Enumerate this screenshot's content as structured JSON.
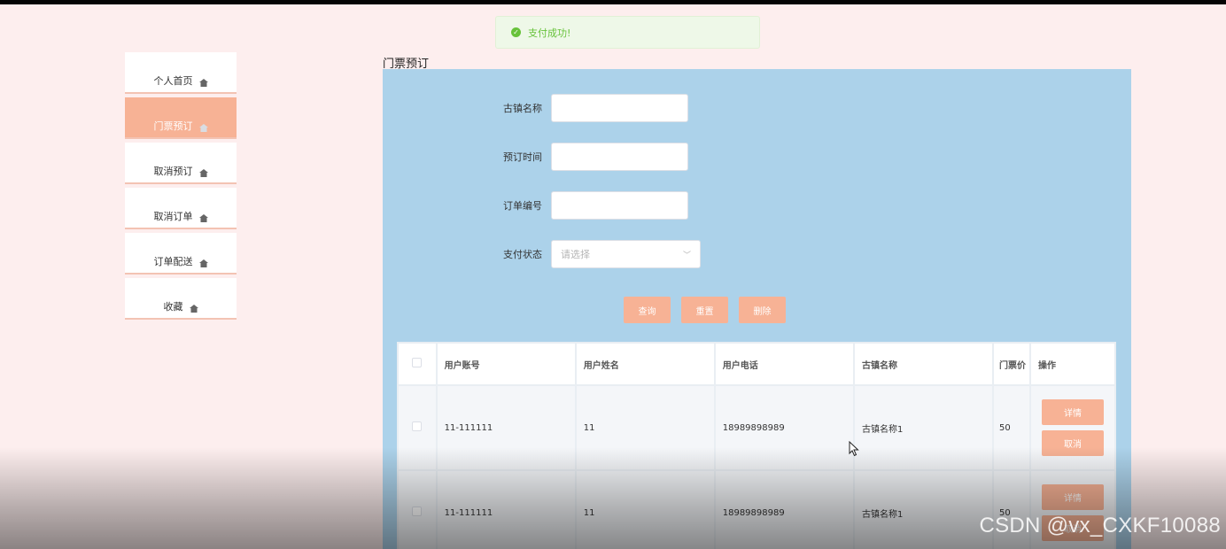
{
  "toast": {
    "message": "支付成功!"
  },
  "sidebar": {
    "items": [
      {
        "label": "个人首页",
        "icon": "house-icon",
        "active": false
      },
      {
        "label": "门票预订",
        "icon": "house-icon",
        "active": true
      },
      {
        "label": "取消预订",
        "icon": "house-icon",
        "active": false
      },
      {
        "label": "取消订单",
        "icon": "house-icon",
        "active": false
      },
      {
        "label": "订单配送",
        "icon": "house-icon",
        "active": false
      },
      {
        "label": "收藏",
        "icon": "house-icon",
        "active": false
      }
    ]
  },
  "page": {
    "title": "门票预订"
  },
  "form": {
    "town_name_label": "古镇名称",
    "town_name_value": "",
    "booking_time_label": "预订时间",
    "booking_time_value": "",
    "order_no_label": "订单编号",
    "order_no_value": "",
    "pay_status_label": "支付状态",
    "pay_status_placeholder": "请选择"
  },
  "buttons": {
    "search": "查询",
    "reset": "重置",
    "delete": "删除"
  },
  "table": {
    "columns": [
      "用户账号",
      "用户姓名",
      "用户电话",
      "古镇名称",
      "门票价",
      "操作"
    ],
    "rows": [
      {
        "account": "11-111111",
        "name": "11",
        "phone": "18989898989",
        "town": "古镇名称1",
        "price": "50",
        "detail": "详情",
        "cancel": "取消"
      },
      {
        "account": "11-111111",
        "name": "11",
        "phone": "18989898989",
        "town": "古镇名称1",
        "price": "50",
        "detail": "详情",
        "cancel": "取消"
      }
    ]
  },
  "watermark": "CSDN @vx_CXKF10088",
  "colors": {
    "accent": "#f7b295",
    "panel": "#acd2ea",
    "background": "#fdeeee",
    "success": "#67c23a"
  }
}
